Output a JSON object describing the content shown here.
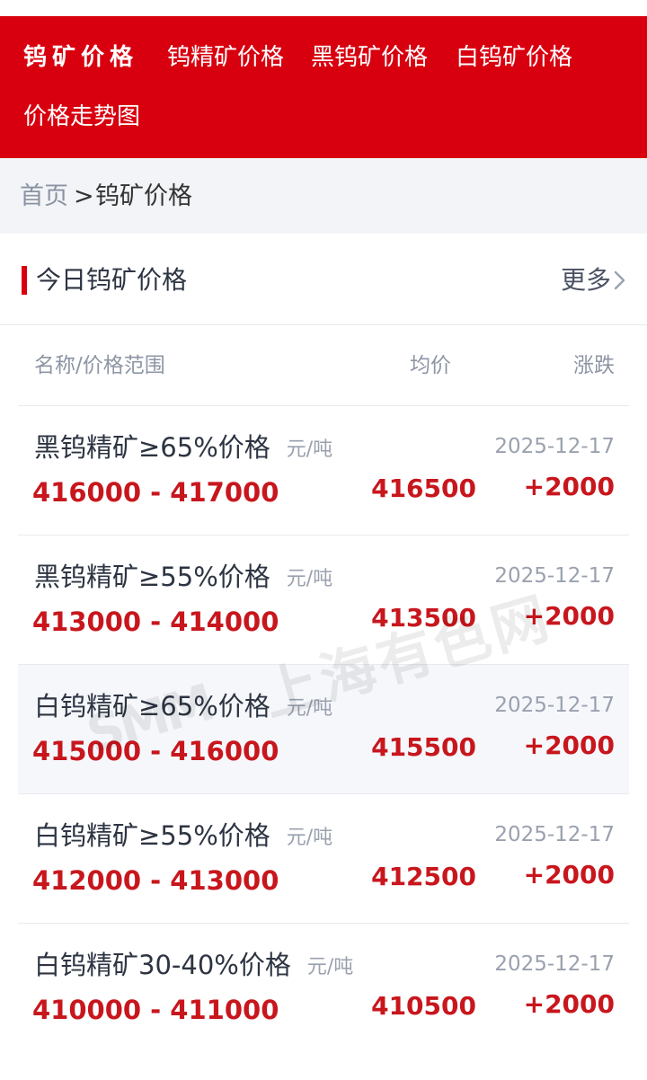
{
  "nav": {
    "items": [
      {
        "label": "钨矿价格"
      },
      {
        "label": "钨精矿价格"
      },
      {
        "label": "黑钨矿价格"
      },
      {
        "label": "白钨矿价格"
      },
      {
        "label": "价格走势图"
      }
    ]
  },
  "breadcrumb": {
    "home": "首页",
    "separator": ">",
    "current": "钨矿价格"
  },
  "section": {
    "title": "今日钨矿价格",
    "more": "更多"
  },
  "table": {
    "headers": {
      "name": "名称/价格范围",
      "avg": "均价",
      "change": "涨跌"
    },
    "rows": [
      {
        "name": "黑钨精矿≥65%价格",
        "unit": "元/吨",
        "range": "416000 - 417000",
        "avg": "416500",
        "date": "2025-12-17",
        "change": "+2000"
      },
      {
        "name": "黑钨精矿≥55%价格",
        "unit": "元/吨",
        "range": "413000 - 414000",
        "avg": "413500",
        "date": "2025-12-17",
        "change": "+2000"
      },
      {
        "name": "白钨精矿≥65%价格",
        "unit": "元/吨",
        "range": "415000 - 416000",
        "avg": "415500",
        "date": "2025-12-17",
        "change": "+2000"
      },
      {
        "name": "白钨精矿≥55%价格",
        "unit": "元/吨",
        "range": "412000 - 413000",
        "avg": "412500",
        "date": "2025-12-17",
        "change": "+2000"
      },
      {
        "name": "白钨精矿30-40%价格",
        "unit": "元/吨",
        "range": "410000 - 411000",
        "avg": "410500",
        "date": "2025-12-17",
        "change": "+2000"
      }
    ]
  },
  "watermark": {
    "mark": "SMM",
    "text": "上海有色网"
  },
  "colors": {
    "brand_red": "#d8000f",
    "price_red": "#c8161d"
  },
  "icons": {
    "more": "chevron-right-icon"
  }
}
